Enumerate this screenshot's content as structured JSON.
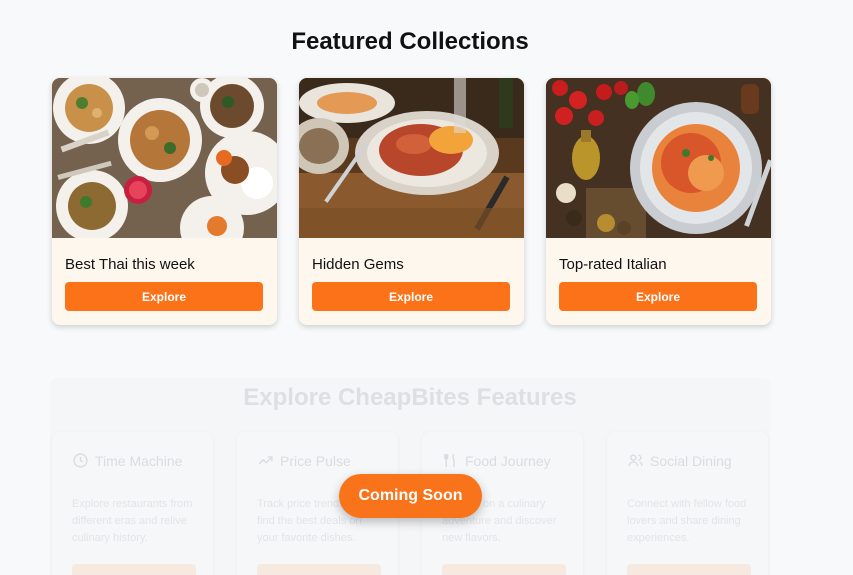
{
  "featured": {
    "title": "Featured Collections",
    "cards": [
      {
        "title": "Best Thai this week",
        "button": "Explore"
      },
      {
        "title": "Hidden Gems",
        "button": "Explore"
      },
      {
        "title": "Top-rated Italian",
        "button": "Explore"
      }
    ]
  },
  "features": {
    "title": "Explore CheapBites Features",
    "items": [
      {
        "icon": "clock-icon",
        "title": "Time Machine",
        "desc": "Explore restaurants from different eras and relive culinary history."
      },
      {
        "icon": "trending-up-icon",
        "title": "Price Pulse",
        "desc": "Track price trends and find the best deals on your favorite dishes."
      },
      {
        "icon": "utensils-icon",
        "title": "Food Journey",
        "desc": "Embark on a culinary adventure and discover new flavors."
      },
      {
        "icon": "users-icon",
        "title": "Social Dining",
        "desc": "Connect with fellow food lovers and share dining experiences."
      }
    ]
  },
  "overlay": {
    "label": "Coming Soon"
  },
  "colors": {
    "accent": "#fb7219",
    "card_bg": "#fdf7ee",
    "page_bg": "#f8f9fb"
  }
}
